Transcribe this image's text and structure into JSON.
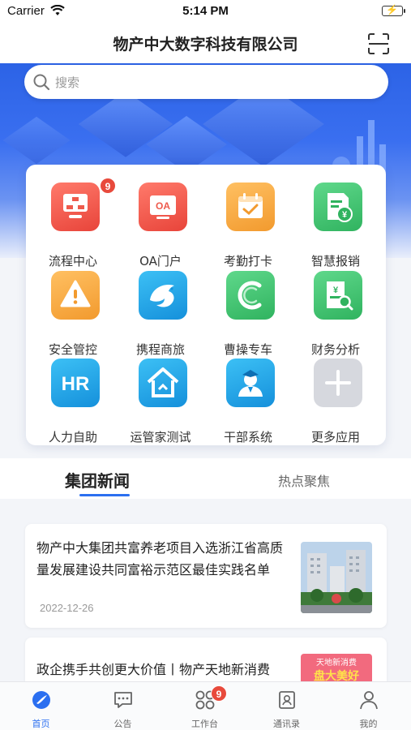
{
  "status_bar": {
    "carrier": "Carrier",
    "time": "5:14 PM"
  },
  "header": {
    "title": "物产中大数字科技有限公司",
    "scan_icon": "scan-icon"
  },
  "search": {
    "placeholder": "搜索"
  },
  "apps": [
    {
      "label": "流程中心",
      "icon": "flowchart-icon",
      "color": "#f0564a",
      "badge": "9"
    },
    {
      "label": "OA门户",
      "icon": "oa-icon",
      "color": "#ee5a4c"
    },
    {
      "label": "考勤打卡",
      "icon": "calendar-check-icon",
      "color": "#f5a533"
    },
    {
      "label": "智慧报销",
      "icon": "receipt-icon",
      "color": "#3cbf6e"
    },
    {
      "label": "安全管控",
      "icon": "warning-icon",
      "color": "#f6a73a"
    },
    {
      "label": "携程商旅",
      "icon": "dolphin-icon",
      "color": "#1ea6e8"
    },
    {
      "label": "曹操专车",
      "icon": "car-c-icon",
      "color": "#3dc07a"
    },
    {
      "label": "财务分析",
      "icon": "finance-search-icon",
      "color": "#3cbf6e"
    },
    {
      "label": "人力自助",
      "icon": "hr-icon",
      "color": "#1aa3e6"
    },
    {
      "label": "运管家测试",
      "icon": "house-icon",
      "color": "#1a9fe8"
    },
    {
      "label": "干部系统",
      "icon": "cadre-icon",
      "color": "#1fa5e6"
    },
    {
      "label": "更多应用",
      "icon": "plus-icon",
      "color": "#d4d6dc"
    }
  ],
  "news_tabs": {
    "active": "集团新闻",
    "other": "热点聚焦"
  },
  "news": [
    {
      "headline": "物产中大集团共富养老项目入选浙江省高质量发展建设共同富裕示范区最佳实践名单",
      "date": "2022-12-26"
    },
    {
      "headline": "政企携手共创更大价值丨物产天地新消费",
      "thumb_text_top": "天地新消费",
      "thumb_text_main": "盘大美好"
    }
  ],
  "tabbar": [
    {
      "label": "首页",
      "icon": "home-icon",
      "active": true
    },
    {
      "label": "公告",
      "icon": "chat-bubble-icon",
      "active": false
    },
    {
      "label": "工作台",
      "icon": "grid-icon",
      "active": false,
      "badge": "9"
    },
    {
      "label": "通讯录",
      "icon": "contacts-icon",
      "active": false
    },
    {
      "label": "我的",
      "icon": "user-icon",
      "active": false
    }
  ],
  "colors": {
    "accent": "#2b6ff0",
    "badge": "#e84a3c"
  }
}
